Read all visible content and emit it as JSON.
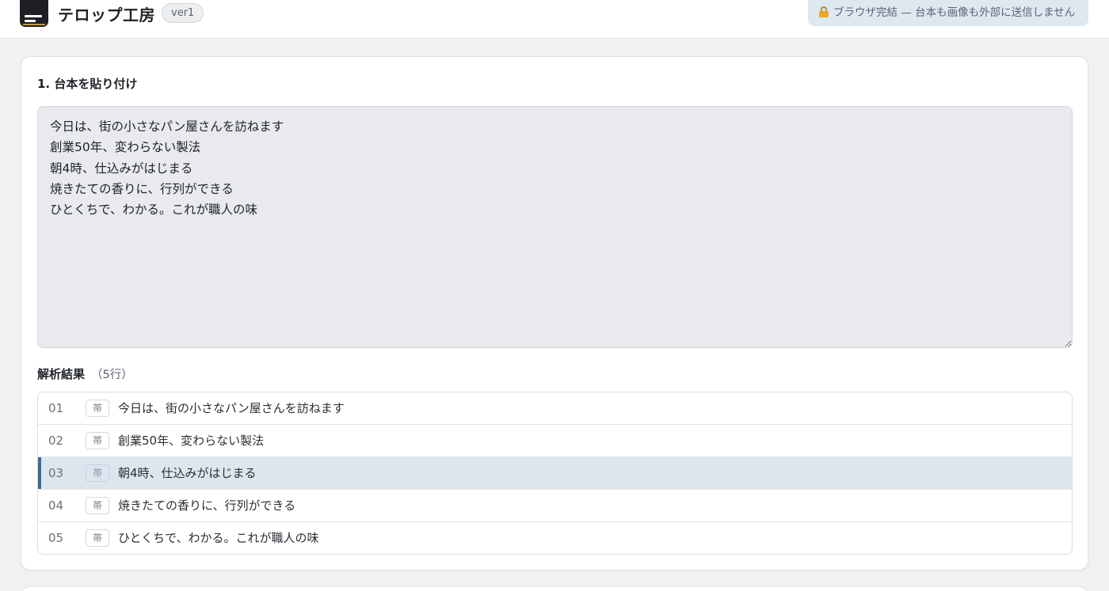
{
  "header": {
    "app_title": "テロップ工房",
    "version": "ver1",
    "privacy_notice": "ブラウザ完結 — 台本も画像も外部に送信しません",
    "privacy_icon": "lock-icon"
  },
  "section1": {
    "title": "1. 台本を貼り付け",
    "script_text": "今日は、街の小さなパン屋さんを訪ねます\n創業50年、変わらない製法\n朝4時、仕込みがはじまる\n焼きたての香りに、行列ができる\nひとくちで、わかる。これが職人の味"
  },
  "results": {
    "title": "解析結果",
    "count": "（5行）",
    "rows": [
      {
        "num": "01",
        "tag": "帯",
        "text": "今日は、街の小さなパン屋さんを訪ねます",
        "selected": false
      },
      {
        "num": "02",
        "tag": "帯",
        "text": "創業50年、変わらない製法",
        "selected": false
      },
      {
        "num": "03",
        "tag": "帯",
        "text": "朝4時、仕込みがはじまる",
        "selected": true
      },
      {
        "num": "04",
        "tag": "帯",
        "text": "焼きたての香りに、行列ができる",
        "selected": false
      },
      {
        "num": "05",
        "tag": "帯",
        "text": "ひとくちで、わかる。これが職人の味",
        "selected": false
      }
    ]
  },
  "colors": {
    "accent": "#3d6a93",
    "selected_row": "#dce6ef",
    "privacy_bg": "#dde8f1"
  }
}
